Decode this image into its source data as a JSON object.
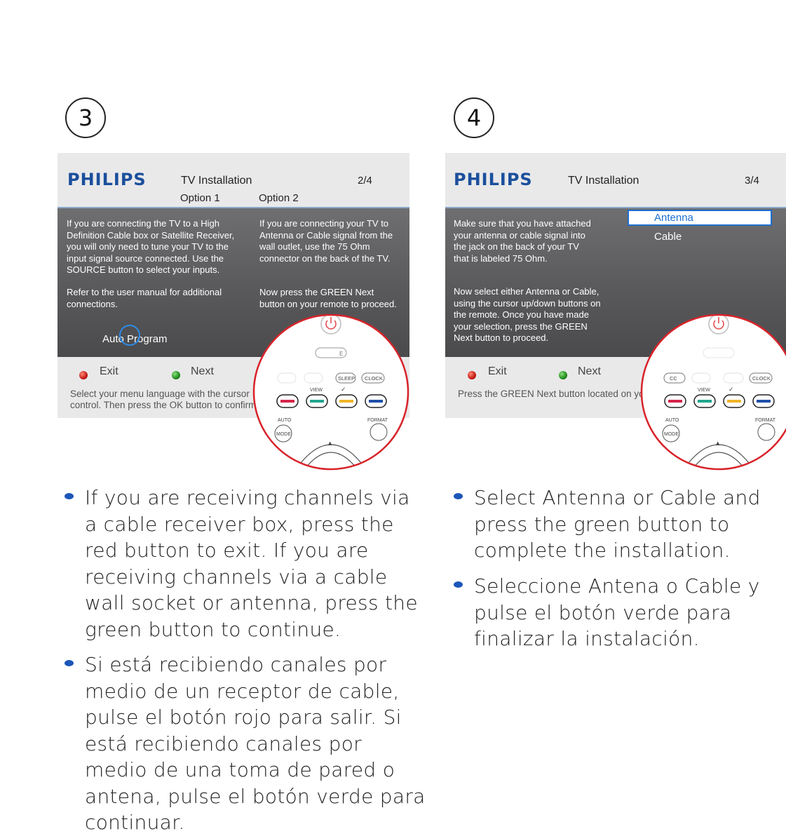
{
  "left": {
    "step": "3",
    "screen": {
      "logo": "PHILIPS",
      "title": "TV Installation",
      "page": "2/4",
      "option1": "Option 1",
      "option2": "Option 2",
      "col1_p1": "If you are connecting the TV to a High Definition Cable box or Satellite Receiver, you will only need to tune your TV to the input signal source connected. Use the SOURCE button to select your inputs.",
      "col1_p2": "Refer to the user manual for additional connections.",
      "col2_p1": "If you are connecting your TV to Antenna or Cable signal from the wall outlet, use the 75 Ohm connector on the back of the TV.",
      "col2_p2": "Now press the GREEN Next button on your remote to proceed.",
      "auto_program": "Auto Program",
      "exit": "Exit",
      "next": "Next",
      "hint_line1": "Select your menu language with the cursor",
      "hint_line2": "control. Then press the OK button to confirm"
    },
    "bullets": [
      "If you are receiving channels via a cable receiver box, press the red button to exit. If you are receiving channels via a cable wall socket or antenna, press the green button to continue.",
      "Si está recibiendo canales por medio de un receptor de cable, pulse el botón rojo para salir. Si está recibiendo canales por medio de una toma de pared o antena, pulse el botón verde para continuar."
    ]
  },
  "right": {
    "step": "4",
    "screen": {
      "logo": "PHILIPS",
      "title": "TV Installation",
      "page": "3/4",
      "p1": "Make sure that you have attached your antenna or cable signal into the jack on the back of your TV that is labeled 75 Ohm.",
      "p2": "Now select either Antenna or Cable, using the cursor up/down buttons on the remote. Once you have made your selection, press the GREEN Next button to proceed.",
      "options": [
        "Antenna",
        "Cable"
      ],
      "selected": "Antenna",
      "exit": "Exit",
      "next": "Next",
      "hint": "Press the GREEN Next button located on your"
    },
    "bullets": [
      "Select Antenna or Cable and press the green button to complete the installation.",
      "Seleccione Antena o Cable y pulse el botón verde para finalizar la instalación."
    ]
  },
  "remote": {
    "sleep": "SLEEP",
    "clock": "CLOCK",
    "cc": "CC",
    "view": "VIEW",
    "check": "✓",
    "auto": "AUTO",
    "mode": "MODE",
    "format": "FORMAT",
    "e": "E",
    "arrow": "▲"
  },
  "colors": {
    "brand": "#1b4f9c",
    "highlight": "#1e6fd0",
    "zoom_ring": "#d8232a",
    "btn_red": "#d6254a",
    "btn_green": "#21a58f",
    "btn_yellow": "#f0b428",
    "btn_blue": "#1e4fa8"
  }
}
